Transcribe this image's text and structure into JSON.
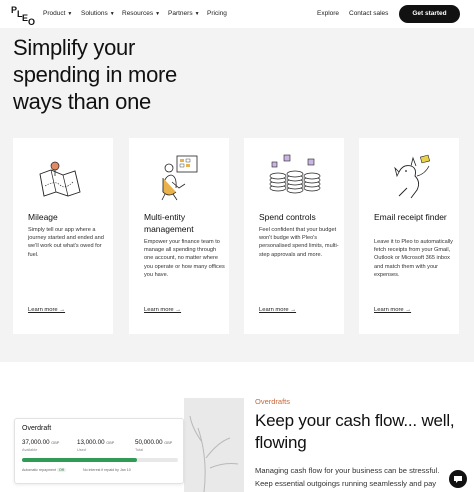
{
  "nav": {
    "logo_text": "PLEO",
    "links": [
      {
        "label": "Product",
        "chevron": true
      },
      {
        "label": "Solutions",
        "chevron": true
      },
      {
        "label": "Resources",
        "chevron": true
      },
      {
        "label": "Partners",
        "chevron": true
      },
      {
        "label": "Pricing",
        "chevron": false
      }
    ],
    "explore": "Explore",
    "contact": "Contact sales",
    "cta": "Get started"
  },
  "hero": {
    "headline_1": "Simplify your",
    "headline_2": "spending in more",
    "headline_3": "ways than one"
  },
  "cards": [
    {
      "title": "Mileage",
      "desc": "Simply tell our app where a journey started and ended and we'll work out what's owed for fuel.",
      "link": "Learn more →",
      "illustration": "map-pin-icon"
    },
    {
      "title": "Multi-entity management",
      "desc": "Empower your finance team to manage all spending through one account, no matter where you operate or how many offices you have.",
      "link": "Learn more →",
      "illustration": "person-dashboard-icon"
    },
    {
      "title": "Spend controls",
      "desc": "Feel confident that your budget won't budge with Pleo's personalised spend limits, multi-step approvals and more.",
      "link": "Learn more →",
      "illustration": "coin-stacks-icon"
    },
    {
      "title": "Email receipt finder",
      "desc": "Leave it to Pleo to automatically fetch receipts from your Gmail, Outlook or Microsoft 365 inbox and match them with your expenses.",
      "link": "Learn more →",
      "illustration": "dog-receipt-icon"
    }
  ],
  "overdraft_widget": {
    "title": "Overdraft",
    "available_value": "37,000.00",
    "available_currency": "GBP",
    "available_label": "Available",
    "used_value": "13,000.00",
    "used_currency": "GBP",
    "used_label": "Used",
    "total_value": "50,000.00",
    "total_currency": "GBP",
    "total_label": "Total",
    "fill_fraction": 0.74,
    "footer_label": "Automatic repayment",
    "footer_pill": "Off",
    "footer_note": "No interest if repaid by Jan 10"
  },
  "overdrafts": {
    "eyebrow": "Overdrafts",
    "headline_1": "Keep your cash flow... well,",
    "headline_2": "flowing",
    "body_1": "Managing cash flow for your business can be stressful.",
    "body_2": "Keep essential outgoings running seamlessly and pay"
  },
  "colors": {
    "accent_orange": "#c7663a",
    "bar_green": "#2f9b55",
    "hero_bg": "#f3f3f3"
  }
}
